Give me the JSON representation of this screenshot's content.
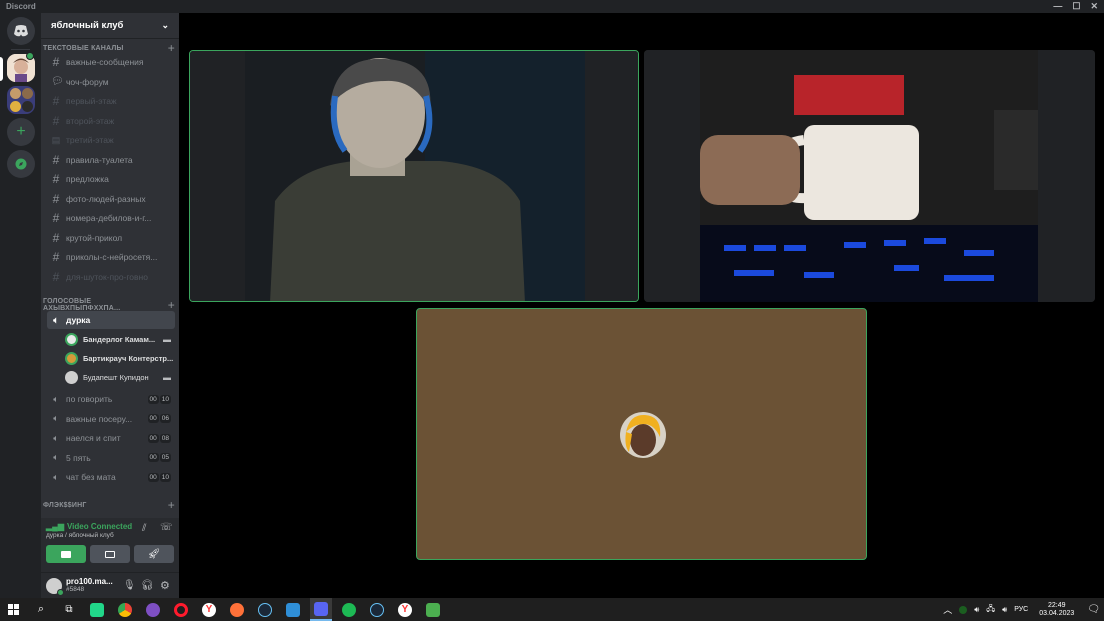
{
  "window": {
    "title": "Discord"
  },
  "guild": {
    "name": "яблочный клуб"
  },
  "categories": {
    "text": "ТЕКСТОВЫЕ КАНАЛЫ",
    "voice": "ГОЛОСОВЫЕ АХЫВХПЫПФХХПА...",
    "flex": "ФЛЭК$$ИНГ"
  },
  "text_channels": [
    {
      "name": "важные-сообщения"
    },
    {
      "name": "чоч-форум"
    },
    {
      "name": "первый-этаж"
    },
    {
      "name": "второй-этаж"
    },
    {
      "name": "третий-этаж"
    },
    {
      "name": "правила-туалета"
    },
    {
      "name": "предложка"
    },
    {
      "name": "фото-людей-разных"
    },
    {
      "name": "номера-дебилов-и-г..."
    },
    {
      "name": "крутой-прикол"
    },
    {
      "name": "приколы-с-нейросетя..."
    },
    {
      "name": "для-шуток-про-говно"
    }
  ],
  "voice_active": {
    "name": "дурка",
    "members": [
      {
        "name": "Бандерлог Камам..."
      },
      {
        "name": "Бартикрауч Контерстр..."
      },
      {
        "name": "Будапешт Купидон"
      }
    ]
  },
  "voice_channels": [
    {
      "name": "по говорить",
      "a": "00",
      "b": "10"
    },
    {
      "name": "важные посеру...",
      "a": "00",
      "b": "06"
    },
    {
      "name": "наелся и спит",
      "a": "00",
      "b": "08"
    },
    {
      "name": "5 пять",
      "a": "00",
      "b": "05"
    },
    {
      "name": "чат без мата",
      "a": "00",
      "b": "10"
    }
  ],
  "voice_status": {
    "status": "Video Connected",
    "location": "дурка / яблочный клуб"
  },
  "user": {
    "name": "pro100.ma...",
    "tag": "#5848"
  },
  "taskbar": {
    "lang": "РУС",
    "time": "22:49",
    "date": "03.04.2023"
  },
  "colors": {
    "accent_green": "#3ba55d",
    "sidebar": "#2f3136",
    "rail": "#202225",
    "tile_brown": "#6b5235"
  }
}
